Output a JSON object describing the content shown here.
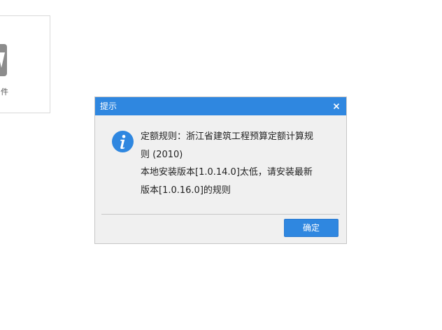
{
  "background_card": {
    "label": "件",
    "icon": "document-app-icon"
  },
  "dialog": {
    "title": "提示",
    "close_icon": "close-icon",
    "message_icon": "info-icon",
    "message_lines": [
      "定额规则：浙江省建筑工程预算定额计算规",
      "则 (2010)",
      "本地安装版本[1.0.14.0]太低，请安装最新",
      "版本[1.0.16.0]的规则"
    ],
    "ok_label": "确定",
    "colors": {
      "titlebar": "#2f87e0",
      "button": "#2f87e0",
      "body": "#f0f0f0",
      "icon": "#2f87e0"
    }
  }
}
